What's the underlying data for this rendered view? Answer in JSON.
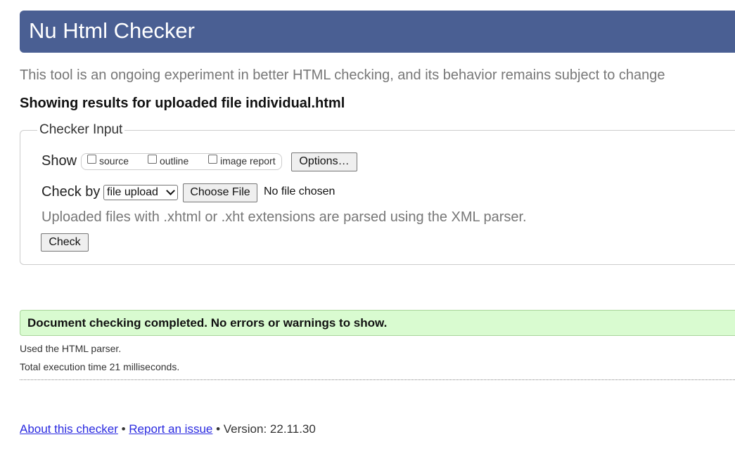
{
  "header": {
    "title": "Nu Html Checker"
  },
  "intro": "This tool is an ongoing experiment in better HTML checking, and its behavior remains subject to change",
  "results_heading": "Showing results for uploaded file individual.html",
  "checker_input": {
    "legend": "Checker Input",
    "show_label": "Show",
    "show_options": [
      {
        "label": "source",
        "checked": false
      },
      {
        "label": "outline",
        "checked": false
      },
      {
        "label": "image report",
        "checked": false
      }
    ],
    "options_button": "Options…",
    "check_by_label": "Check by",
    "check_by_selected": "file upload",
    "choose_file_button": "Choose File",
    "no_file_text": "No file chosen",
    "hint": "Uploaded files with .xhtml or .xht extensions are parsed using the XML parser.",
    "check_button": "Check"
  },
  "result": {
    "message": "Document checking completed. No errors or warnings to show.",
    "parser_info": "Used the HTML parser.",
    "execution_time": "Total execution time 21 milliseconds."
  },
  "footer": {
    "about_link": "About this checker",
    "separator": "•",
    "report_link": "Report an issue",
    "version_text": "• Version: 22.11.30"
  },
  "colors": {
    "header_bg": "#4a5f93",
    "success_bg": "#d9fbd0",
    "link": "#2a2ae0"
  }
}
